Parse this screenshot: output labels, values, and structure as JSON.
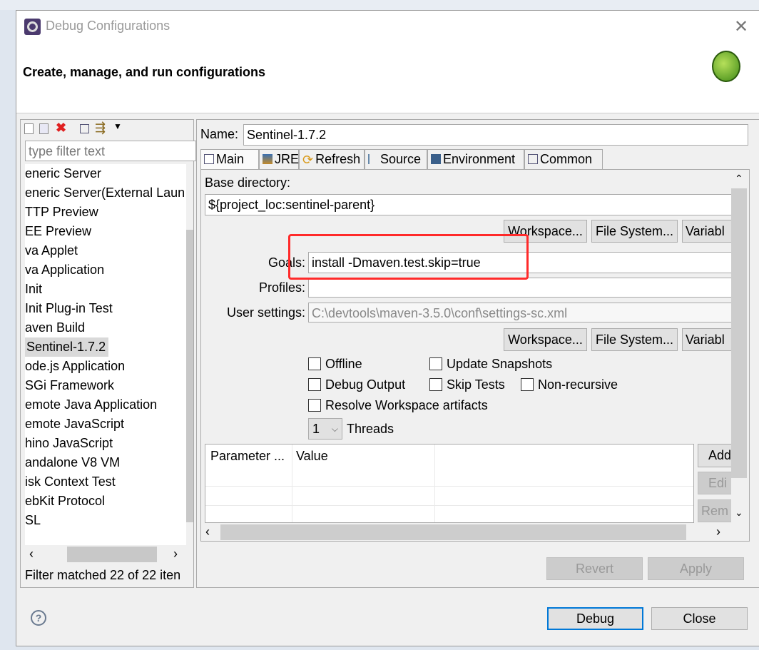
{
  "window": {
    "title": "Debug Configurations",
    "header": "Create, manage, and run configurations"
  },
  "left": {
    "filter_placeholder": "type filter text",
    "items": [
      "eneric Server",
      "eneric Server(External Laun",
      "TTP Preview",
      "EE Preview",
      "va Applet",
      "va Application",
      "Init",
      "Init Plug-in Test",
      "aven Build",
      "Sentinel-1.7.2",
      "ode.js Application",
      "SGi Framework",
      "emote Java Application",
      "emote JavaScript",
      "hino JavaScript",
      "andalone V8 VM",
      "isk Context Test",
      "ebKit Protocol",
      "SL"
    ],
    "selected": "Sentinel-1.7.2",
    "status": "Filter matched 22 of 22 iten"
  },
  "right": {
    "name_label": "Name:",
    "name_value": "Sentinel-1.7.2",
    "tabs": [
      "Main",
      "JRE",
      "Refresh",
      "Source",
      "Environment",
      "Common"
    ],
    "active_tab": "Main",
    "base_dir_label": "Base directory:",
    "base_dir_value": "${project_loc:sentinel-parent}",
    "workspace": "Workspace...",
    "filesystem": "File System...",
    "variables": "Variabl",
    "goals_label": "Goals:",
    "goals_value": "install -Dmaven.test.skip=true",
    "profiles_label": "Profiles:",
    "profiles_value": "",
    "user_settings_label": "User settings:",
    "user_settings_value": "C:\\devtools\\maven-3.5.0\\conf\\settings-sc.xml",
    "checkboxes": {
      "offline": "Offline",
      "update": "Update Snapshots",
      "debug_output": "Debug Output",
      "skip_tests": "Skip Tests",
      "non_recursive": "Non-recursive",
      "resolve": "Resolve Workspace artifacts"
    },
    "threads_value": "1",
    "threads_label": "Threads",
    "table": {
      "headers": [
        "Parameter ...",
        "Value"
      ]
    },
    "add": "Add",
    "edit": "Edi",
    "remove": "Rem",
    "revert": "Revert",
    "apply": "Apply"
  },
  "footer": {
    "debug": "Debug",
    "close": "Close"
  },
  "colors": {
    "highlight_box": "#ff2a2a",
    "selection": "#d9d9d9",
    "default_button_border": "#0078d7"
  }
}
